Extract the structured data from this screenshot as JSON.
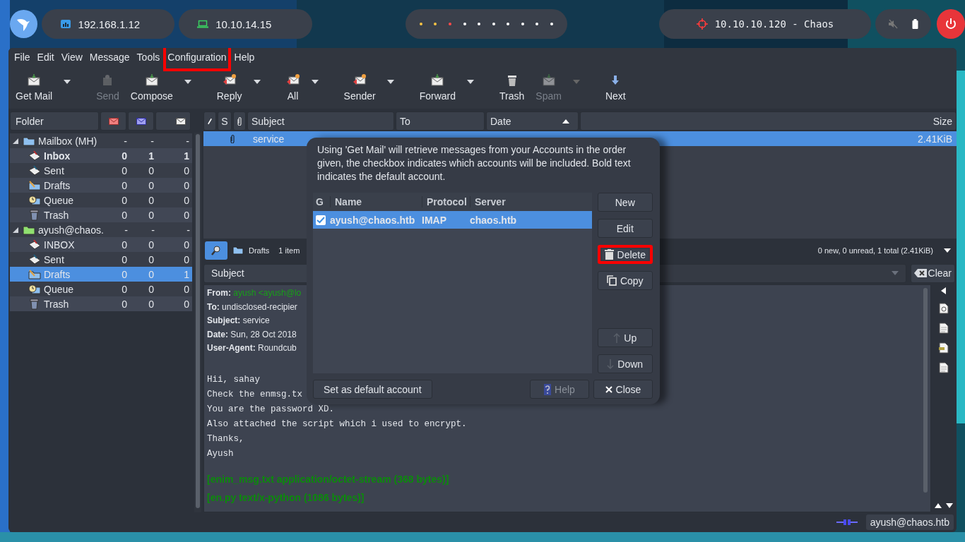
{
  "top_bar": {
    "addresses": [
      {
        "text": "192.168.1.12",
        "kind": "lan"
      },
      {
        "text": "10.10.14.15",
        "kind": "vpn"
      }
    ],
    "dots": [
      {
        "color": "#f6c344"
      },
      {
        "color": "#f6c344"
      },
      {
        "color": "#ff4a4a"
      },
      {
        "color": "#ffffff"
      },
      {
        "color": "#ffffff"
      },
      {
        "color": "#ffffff"
      },
      {
        "color": "#ffffff"
      },
      {
        "color": "#ffffff"
      },
      {
        "color": "#ffffff"
      },
      {
        "color": "#ffffff"
      }
    ],
    "target": "10.10.10.120 - Chaos"
  },
  "menu": [
    {
      "label": "File",
      "highlighted": false
    },
    {
      "label": "Edit",
      "highlighted": false
    },
    {
      "label": "View",
      "highlighted": false
    },
    {
      "label": "Message",
      "highlighted": false
    },
    {
      "label": "Tools",
      "highlighted": false
    },
    {
      "label": "Configuration",
      "highlighted": true
    },
    {
      "label": "Help",
      "highlighted": false
    }
  ],
  "toolbar": [
    {
      "label": "Get Mail",
      "kind": "mail",
      "disabled": false,
      "dropdown": true
    },
    {
      "label": "Send",
      "kind": "send",
      "disabled": true,
      "dropdown": false
    },
    {
      "label": "Compose",
      "kind": "mail",
      "disabled": false,
      "dropdown": true
    },
    {
      "label": "Reply",
      "kind": "reply",
      "disabled": false,
      "dropdown": true
    },
    {
      "label": "All",
      "kind": "reply",
      "disabled": false,
      "dropdown": true
    },
    {
      "label": "Sender",
      "kind": "reply",
      "disabled": false,
      "dropdown": true
    },
    {
      "label": "Forward",
      "kind": "mail",
      "disabled": false,
      "dropdown": true
    },
    {
      "label": "Trash",
      "kind": "trash",
      "disabled": false,
      "dropdown": false
    },
    {
      "label": "Spam",
      "kind": "mail",
      "disabled": true,
      "dropdown": true
    },
    {
      "label": "Next",
      "kind": "next",
      "disabled": false,
      "dropdown": false
    }
  ],
  "folder_pane": {
    "heading": "Folder",
    "tree": [
      {
        "name": "Mailbox (MH)",
        "kind": "local",
        "new": "-",
        "unread": "-",
        "total": "-",
        "bold": false,
        "selected": false,
        "expanded": true,
        "children": [
          {
            "name": "Inbox",
            "kind": "inbox",
            "new": "0",
            "unread": "1",
            "total": "1",
            "bold": true,
            "selected": false
          },
          {
            "name": "Sent",
            "kind": "sent",
            "new": "0",
            "unread": "0",
            "total": "0",
            "bold": false,
            "selected": false
          },
          {
            "name": "Drafts",
            "kind": "drafts",
            "new": "0",
            "unread": "0",
            "total": "0",
            "bold": false,
            "selected": false
          },
          {
            "name": "Queue",
            "kind": "queue",
            "new": "0",
            "unread": "0",
            "total": "0",
            "bold": false,
            "selected": false
          },
          {
            "name": "Trash",
            "kind": "trash",
            "new": "0",
            "unread": "0",
            "total": "0",
            "bold": false,
            "selected": false
          }
        ]
      },
      {
        "name": "ayush@chaos.",
        "kind": "imap",
        "new": "-",
        "unread": "-",
        "total": "-",
        "bold": false,
        "selected": false,
        "expanded": true,
        "children": [
          {
            "name": "INBOX",
            "kind": "inbox",
            "new": "0",
            "unread": "0",
            "total": "0",
            "bold": false,
            "selected": false
          },
          {
            "name": "Sent",
            "kind": "sent",
            "new": "0",
            "unread": "0",
            "total": "0",
            "bold": false,
            "selected": false
          },
          {
            "name": "Drafts",
            "kind": "drafts",
            "new": "0",
            "unread": "0",
            "total": "1",
            "bold": false,
            "selected": true
          },
          {
            "name": "Queue",
            "kind": "queue",
            "new": "0",
            "unread": "0",
            "total": "0",
            "bold": false,
            "selected": false
          },
          {
            "name": "Trash",
            "kind": "trash",
            "new": "0",
            "unread": "0",
            "total": "0",
            "bold": false,
            "selected": false
          }
        ]
      }
    ]
  },
  "message_list": {
    "status_label": "S",
    "columns": [
      {
        "label": "Subject",
        "sorted": false
      },
      {
        "label": "To",
        "sorted": false
      },
      {
        "label": "Date",
        "sorted": true
      },
      {
        "label": "Size",
        "sorted": false
      }
    ],
    "rows": [
      {
        "subject": "service",
        "size": "2.41KiB",
        "attachment": true,
        "selected": true
      }
    ]
  },
  "filter_bar": {
    "folder": "Drafts",
    "selection": "1 item",
    "summary": "0 new, 0 unread, 1 total (2.41KiB)"
  },
  "search": {
    "field": "Subject",
    "clear": "Clear"
  },
  "preview": {
    "headers": [
      {
        "label": "From:",
        "value": "ayush <ayush@lo",
        "link": true
      },
      {
        "label": "To:",
        "value": "undisclosed-recipier",
        "link": false
      },
      {
        "label": "Subject:",
        "value": "service",
        "link": false
      },
      {
        "label": "Date:",
        "value": "Sun, 28 Oct 2018",
        "link": false
      },
      {
        "label": "User-Agent:",
        "value": "Roundcub",
        "link": false
      }
    ],
    "body": [
      "Hii, sahay",
      "Check the enmsg.tx",
      "You are the password XD.",
      "Also attached the script which i used to encrypt.",
      "Thanks,",
      "Ayush"
    ],
    "attachments": [
      "[enim_msg.txt  application/octet-stream (368 bytes)]",
      "[en.py  text/x-python (1086 bytes)]"
    ]
  },
  "status_bar": {
    "account": "ayush@chaos.htb"
  },
  "dialog": {
    "description": "Using 'Get Mail' will retrieve messages from your Accounts in the order given, the checkbox indicates which accounts will be included. Bold text indicates the default account.",
    "columns": [
      "G",
      "Name",
      "Protocol",
      "Server"
    ],
    "accounts": [
      {
        "checked": true,
        "name": "ayush@chaos.htb",
        "protocol": "IMAP",
        "server": "chaos.htb",
        "selected": true,
        "default": true
      }
    ],
    "side_buttons": [
      {
        "label": "New",
        "kind": "plain",
        "disabled": false,
        "highlighted": false
      },
      {
        "label": "Edit",
        "kind": "plain",
        "disabled": false,
        "highlighted": false
      },
      {
        "label": "Delete",
        "kind": "delete",
        "disabled": false,
        "highlighted": true
      },
      {
        "label": "Copy",
        "kind": "copy",
        "disabled": false,
        "highlighted": false
      }
    ],
    "move_buttons": [
      {
        "label": "Up",
        "kind": "up",
        "disabled": false
      },
      {
        "label": "Down",
        "kind": "down",
        "disabled": false
      }
    ],
    "default_button": "Set as default account",
    "footer_buttons": [
      {
        "label": "Help",
        "kind": "help",
        "disabled": true
      },
      {
        "label": "Close",
        "kind": "close",
        "disabled": false
      }
    ]
  }
}
